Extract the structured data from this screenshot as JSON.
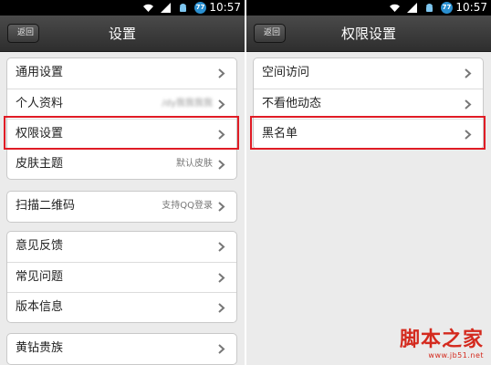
{
  "status_bar": {
    "time": "10:57",
    "badge": "77"
  },
  "left_screen": {
    "back_label": "返回",
    "title": "设置",
    "groups": [
      {
        "items": [
          {
            "label": "通用设置",
            "value": ""
          },
          {
            "label": "个人资料",
            "value": "/dy我我我我"
          },
          {
            "label": "权限设置",
            "value": ""
          },
          {
            "label": "皮肤主题",
            "value": "默认皮肤"
          }
        ]
      },
      {
        "items": [
          {
            "label": "扫描二维码",
            "value": "支持QQ登录"
          }
        ]
      },
      {
        "items": [
          {
            "label": "意见反馈",
            "value": ""
          },
          {
            "label": "常见问题",
            "value": ""
          },
          {
            "label": "版本信息",
            "value": ""
          }
        ]
      },
      {
        "items": [
          {
            "label": "黄钻贵族",
            "value": ""
          }
        ]
      }
    ]
  },
  "right_screen": {
    "back_label": "返回",
    "title": "权限设置",
    "items": [
      {
        "label": "空间访问"
      },
      {
        "label": "不看他动态"
      },
      {
        "label": "黑名单"
      }
    ]
  },
  "watermark": {
    "brand": "脚本之家",
    "url": "www.jb51.net"
  },
  "colors": {
    "highlight": "#e01c25",
    "titlebar": "#3a3a3a",
    "background": "#ebebeb"
  },
  "icons": [
    "wifi-icon",
    "signal-icon",
    "android-icon",
    "badge-icon",
    "back-arrow-icon",
    "chevron-right-icon"
  ]
}
